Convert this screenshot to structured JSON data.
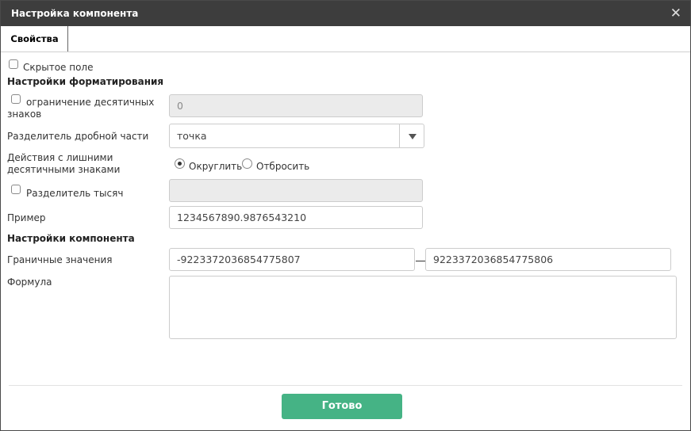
{
  "dialog": {
    "title": "Настройка компонента",
    "close_glyph": "✕"
  },
  "tabs": [
    {
      "label": "Свойства",
      "active": true
    }
  ],
  "form": {
    "hidden_field": {
      "label": "Скрытое поле",
      "checked": false
    },
    "formatting_heading": "Настройки форматирования",
    "decimal_limit": {
      "label_line1": "ограничение десятичных",
      "label_line2": "знаков",
      "checked": false,
      "value": "0",
      "disabled": true
    },
    "decimal_separator": {
      "label": "Разделитель дробной части",
      "value": "точка"
    },
    "extra_decimals": {
      "label_line1": "Действия с лишними",
      "label_line2": "десятичными знаками",
      "options": [
        {
          "label": "Округлить",
          "selected": true
        },
        {
          "label": "Отбросить",
          "selected": false
        }
      ]
    },
    "thousands_separator": {
      "label": "Разделитель тысяч",
      "checked": false,
      "value": "",
      "disabled": true
    },
    "example": {
      "label": "Пример",
      "value": "1234567890.9876543210"
    },
    "component_heading": "Настройки компонента",
    "bounds": {
      "label": "Граничные значения",
      "min": "-9223372036854775807",
      "max": "9223372036854775806"
    },
    "formula": {
      "label": "Формула",
      "value": ""
    }
  },
  "footer": {
    "done_label": "Готово",
    "accent": "#45b385"
  }
}
